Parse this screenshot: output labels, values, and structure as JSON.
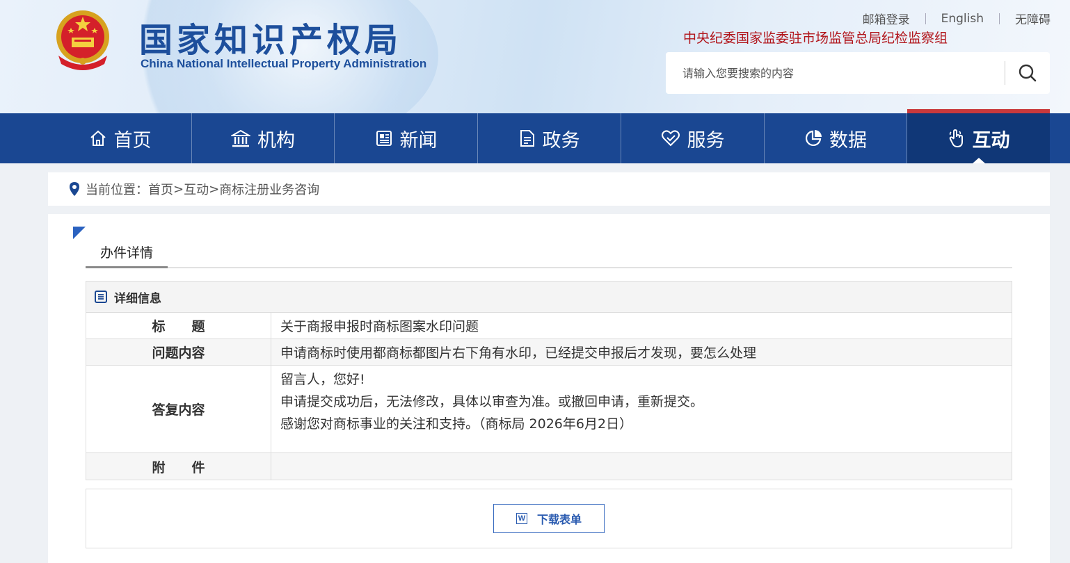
{
  "header": {
    "logo_cn": "国家知识产权局",
    "logo_en": "China National Intellectual Property Administration",
    "top_links": [
      "邮箱登录",
      "English",
      "无障碍"
    ],
    "discipline_text": "中央纪委国家监委驻市场监管总局纪检监察组",
    "search_placeholder": "请输入您要搜索的内容"
  },
  "nav": {
    "items": [
      {
        "label": "首页",
        "icon": "home-icon"
      },
      {
        "label": "机构",
        "icon": "institution-icon"
      },
      {
        "label": "新闻",
        "icon": "news-icon"
      },
      {
        "label": "政务",
        "icon": "document-icon"
      },
      {
        "label": "服务",
        "icon": "heart-icon"
      },
      {
        "label": "数据",
        "icon": "pie-chart-icon"
      },
      {
        "label": "互动",
        "icon": "hand-pointer-icon"
      }
    ],
    "active_index": 6,
    "colors": {
      "bar": "#1a4792",
      "active": "#103777",
      "active_top": "#c9393c"
    }
  },
  "breadcrumb": {
    "prefix": "当前位置：",
    "items": [
      "首页",
      "互动",
      "商标注册业务咨询"
    ],
    "separator": ">"
  },
  "panel": {
    "tab_label": "办件详情",
    "detail_title": "详细信息",
    "rows": {
      "title_key": "标　　题",
      "title_val": "关于商报申报时商标图案水印问题",
      "question_key": "问题内容",
      "question_val": "申请商标时使用都商标都图片右下角有水印，已经提交申报后才发现，要怎么处理",
      "reply_key": "答复内容",
      "reply_lines": [
        "留言人，您好!",
        "申请提交成功后，无法修改，具体以审查为准。或撤回申请，重新提交。",
        "感谢您对商标事业的关注和支持。（商标局 2026年6月2日）"
      ],
      "attachment_key": "附　　件",
      "attachment_val": ""
    },
    "download_label": "下载表单",
    "download_icon_letter": "W"
  }
}
